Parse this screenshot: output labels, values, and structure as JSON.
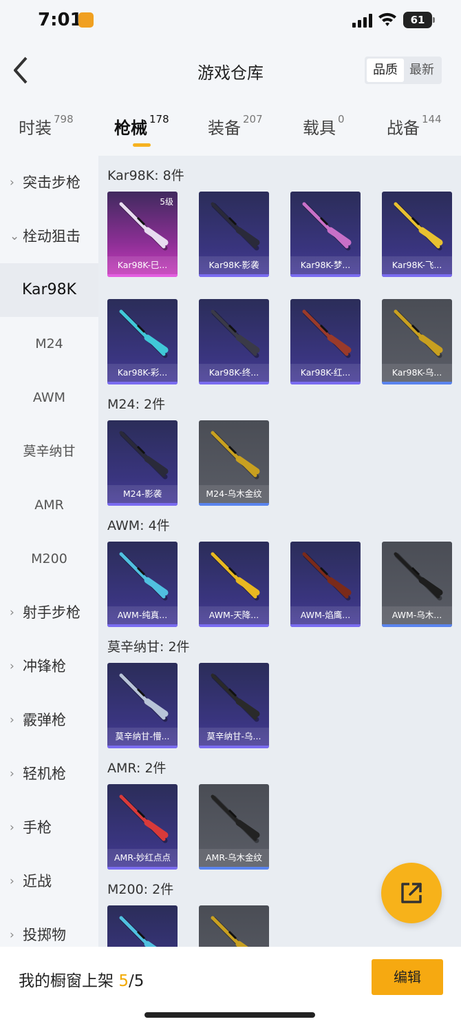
{
  "status": {
    "time": "7:01",
    "battery": "61"
  },
  "header": {
    "title": "游戏仓库",
    "sort_options": [
      "品质",
      "最新"
    ]
  },
  "tabs": [
    {
      "label": "时装",
      "count": "798"
    },
    {
      "label": "枪械",
      "count": "178"
    },
    {
      "label": "装备",
      "count": "207"
    },
    {
      "label": "载具",
      "count": "0"
    },
    {
      "label": "战备",
      "count": "144"
    }
  ],
  "sidebar": {
    "items": [
      "突击步枪",
      "栓动狙击",
      "Kar98K",
      "M24",
      "AWM",
      "莫辛纳甘",
      "AMR",
      "M200",
      "射手步枪",
      "冲锋枪",
      "霰弹枪",
      "轻机枪",
      "手枪",
      "近战",
      "投掷物"
    ]
  },
  "sections": [
    {
      "title": "Kar98K: 8件",
      "items": [
        {
          "name": "Kar98K-巳...",
          "badge": "5级",
          "rarity": "pink",
          "gun_color": "#e8dcf0"
        },
        {
          "name": "Kar98K-影袭",
          "rarity": "purple",
          "gun_color": "#2a2a3a"
        },
        {
          "name": "Kar98K-梦...",
          "rarity": "purple",
          "gun_color": "#c870c8"
        },
        {
          "name": "Kar98K-飞...",
          "rarity": "purple",
          "gun_color": "#e8c030"
        },
        {
          "name": "Kar98K-彩...",
          "rarity": "purple",
          "gun_color": "#40c8d8"
        },
        {
          "name": "Kar98K-终...",
          "rarity": "purple",
          "gun_color": "#3a3a48"
        },
        {
          "name": "Kar98K-红...",
          "rarity": "purple",
          "gun_color": "#9a3a2a"
        },
        {
          "name": "Kar98K-乌...",
          "rarity": "gray",
          "gun_color": "#c8a020"
        }
      ]
    },
    {
      "title": "M24: 2件",
      "items": [
        {
          "name": "M24-影袭",
          "rarity": "purple",
          "gun_color": "#2a2a3a"
        },
        {
          "name": "M24-乌木金纹",
          "rarity": "gray",
          "gun_color": "#c8a020"
        }
      ]
    },
    {
      "title": "AWM: 4件",
      "items": [
        {
          "name": "AWM-纯真...",
          "rarity": "purple",
          "gun_color": "#50c0e0"
        },
        {
          "name": "AWM-天降...",
          "rarity": "purple",
          "gun_color": "#e8b820"
        },
        {
          "name": "AWM-焰鹰...",
          "rarity": "purple",
          "gun_color": "#7a2a1a"
        },
        {
          "name": "AWM-乌木...",
          "rarity": "gray",
          "gun_color": "#1e1e1e"
        }
      ]
    },
    {
      "title": "莫辛纳甘: 2件",
      "items": [
        {
          "name": "莫辛纳甘-懵...",
          "rarity": "purple",
          "gun_color": "#b8c4d8"
        },
        {
          "name": "莫辛纳甘-乌...",
          "rarity": "purple",
          "gun_color": "#2a2a2a"
        }
      ]
    },
    {
      "title": "AMR: 2件",
      "items": [
        {
          "name": "AMR-妙红点点",
          "rarity": "purple",
          "gun_color": "#d83a3a"
        },
        {
          "name": "AMR-乌木金纹",
          "rarity": "gray",
          "gun_color": "#222222"
        }
      ]
    },
    {
      "title": "M200: 2件",
      "items": [
        {
          "name": "",
          "rarity": "purple",
          "gun_color": "#50c0e0"
        },
        {
          "name": "",
          "rarity": "gray",
          "gun_color": "#c8a020"
        }
      ]
    }
  ],
  "bottom": {
    "showcase_label": "我的橱窗上架",
    "showcase_current": "5",
    "showcase_total": "/5",
    "edit_label": "编辑"
  },
  "icons": {
    "back": "back-arrow-icon",
    "share": "share-external-icon",
    "chevron": "chevron-icon"
  },
  "colors": {
    "accent": "#f6a911",
    "tab_underline": "#f6b220"
  }
}
